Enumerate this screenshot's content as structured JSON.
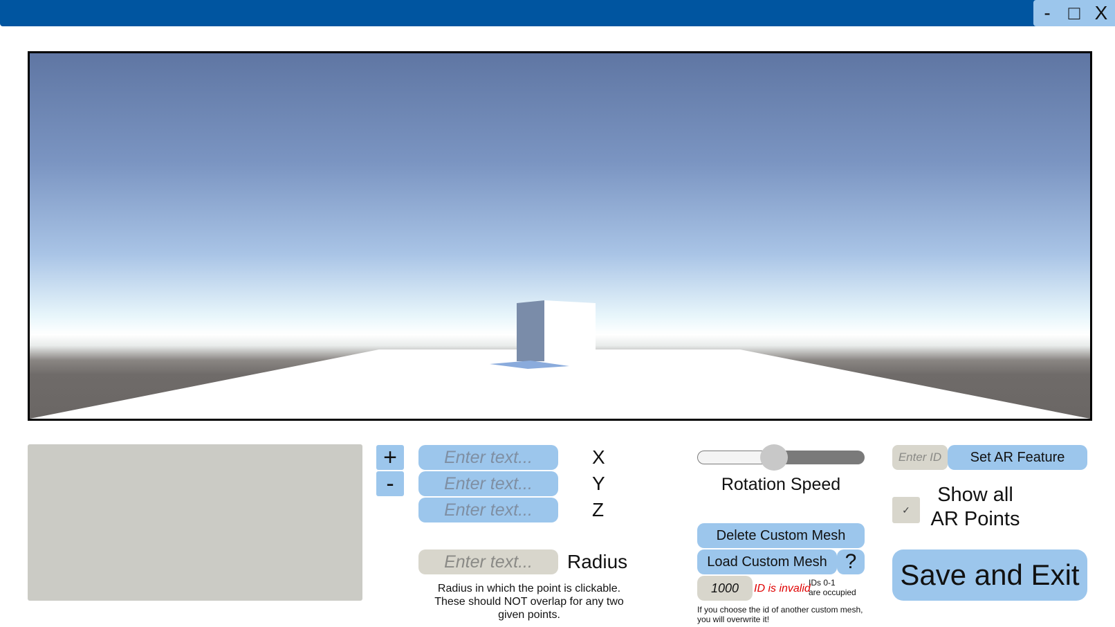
{
  "window": {
    "minimize_label": "-",
    "maximize_label": "□",
    "close_label": "X"
  },
  "point_editor": {
    "add_label": "+",
    "remove_label": "-",
    "x": {
      "placeholder": "Enter text...",
      "label": "X"
    },
    "y": {
      "placeholder": "Enter text...",
      "label": "Y"
    },
    "z": {
      "placeholder": "Enter text...",
      "label": "Z"
    },
    "radius": {
      "placeholder": "Enter text...",
      "label": "Radius",
      "help_line1": "Radius in which the point is clickable.",
      "help_line2": "These should NOT overlap for any two",
      "help_line3": "given points."
    }
  },
  "rotation": {
    "label": "Rotation Speed",
    "value_fraction": 0.46
  },
  "mesh": {
    "delete_label": "Delete Custom Mesh",
    "load_label": "Load Custom Mesh",
    "help_label": "?",
    "id_value": "1000",
    "id_status": "ID is invalid",
    "ids_note_line1": "IDs 0-1",
    "ids_note_line2": "are occupied",
    "warning_line1": "If you choose the id of another custom mesh,",
    "warning_line2": "you will overwrite it!"
  },
  "ar": {
    "id_placeholder": "Enter ID",
    "set_feature_label": "Set AR Feature",
    "show_points_line1": "Show all",
    "show_points_line2": "AR Points",
    "show_points_checked": true,
    "checkmark": "✓"
  },
  "save_exit_label": "Save and Exit",
  "colors": {
    "title_bar": "#0055a0",
    "button": "#9cc6ec",
    "panel": "#cbcbc5",
    "invalid_text": "#e00000"
  }
}
